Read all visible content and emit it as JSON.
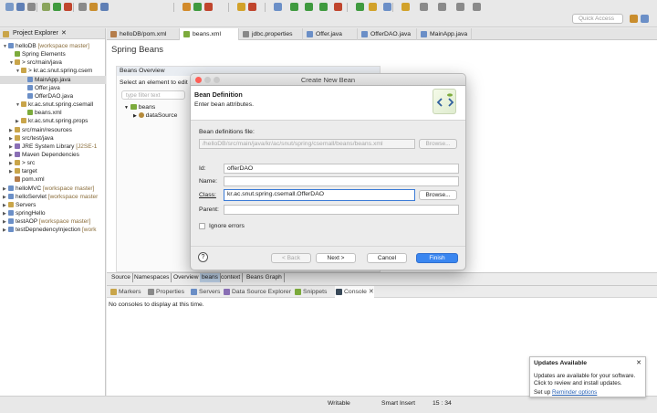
{
  "toolbar": {
    "quick_access_placeholder": "Quick Access"
  },
  "explorer": {
    "title": "Project Explorer",
    "tree": [
      {
        "indent": 0,
        "arrow": "▼",
        "label": "helloDB",
        "deco": " [workspace master]",
        "icon_color": "#6b8fc7"
      },
      {
        "indent": 1,
        "arrow": "",
        "label": "Spring Elements",
        "deco": "",
        "icon_color": "#7cab3c"
      },
      {
        "indent": 1,
        "arrow": "▼",
        "label": "> src/main/java",
        "deco": "",
        "icon_color": "#c9a54a"
      },
      {
        "indent": 2,
        "arrow": "▼",
        "label": "> kr.ac.snut.spring.csem",
        "deco": "",
        "icon_color": "#c9a54a"
      },
      {
        "indent": 3,
        "arrow": "",
        "label": "MainApp.java",
        "deco": "",
        "icon_color": "#6b8fc7",
        "selected": true
      },
      {
        "indent": 3,
        "arrow": "",
        "label": "Offer.java",
        "deco": "",
        "icon_color": "#6b8fc7"
      },
      {
        "indent": 3,
        "arrow": "",
        "label": "OfferDAO.java",
        "deco": "",
        "icon_color": "#6b8fc7"
      },
      {
        "indent": 2,
        "arrow": "▼",
        "label": "kr.ac.snut.spring.csemall",
        "deco": "",
        "icon_color": "#c9a54a"
      },
      {
        "indent": 3,
        "arrow": "",
        "label": "beans.xml",
        "deco": "",
        "icon_color": "#7cab3c"
      },
      {
        "indent": 2,
        "arrow": "▶",
        "label": "kr.ac.snut.spring.props",
        "deco": "",
        "icon_color": "#c9a54a"
      },
      {
        "indent": 1,
        "arrow": "▶",
        "label": "src/main/resources",
        "deco": "",
        "icon_color": "#c9a54a"
      },
      {
        "indent": 1,
        "arrow": "▶",
        "label": "src/test/java",
        "deco": "",
        "icon_color": "#c9a54a"
      },
      {
        "indent": 1,
        "arrow": "▶",
        "label": "JRE System Library",
        "deco": " [J2SE-1",
        "icon_color": "#8a6fb5"
      },
      {
        "indent": 1,
        "arrow": "▶",
        "label": "Maven Dependencies",
        "deco": "",
        "icon_color": "#8a6fb5"
      },
      {
        "indent": 1,
        "arrow": "▶",
        "label": "> src",
        "deco": "",
        "icon_color": "#c9a54a"
      },
      {
        "indent": 1,
        "arrow": "▶",
        "label": "target",
        "deco": "",
        "icon_color": "#c9a54a"
      },
      {
        "indent": 1,
        "arrow": "",
        "label": "pom.xml",
        "deco": "",
        "icon_color": "#b57d4a"
      },
      {
        "indent": 0,
        "arrow": "▶",
        "label": "helloMVC",
        "deco": " [workspace master]",
        "icon_color": "#6b8fc7"
      },
      {
        "indent": 0,
        "arrow": "▶",
        "label": "helloServlet",
        "deco": " [workspace master",
        "icon_color": "#6b8fc7"
      },
      {
        "indent": 0,
        "arrow": "▶",
        "label": "Servers",
        "deco": "",
        "icon_color": "#c9a54a"
      },
      {
        "indent": 0,
        "arrow": "▶",
        "label": "springHello",
        "deco": "",
        "icon_color": "#6b8fc7"
      },
      {
        "indent": 0,
        "arrow": "▶",
        "label": "testAOP",
        "deco": " [workspace master]",
        "icon_color": "#6b8fc7"
      },
      {
        "indent": 0,
        "arrow": "▶",
        "label": "testDepnedencyInjection",
        "deco": " [work",
        "icon_color": "#6b8fc7"
      }
    ]
  },
  "editor_tabs": [
    {
      "label": "helloDB/pom.xml",
      "icon_color": "#b57d4a",
      "active": false
    },
    {
      "label": "beans.xml",
      "icon_color": "#7cab3c",
      "active": true
    },
    {
      "label": "jdbc.properties",
      "icon_color": "#888888",
      "active": false
    },
    {
      "label": "Offer.java",
      "icon_color": "#6b8fc7",
      "active": false
    },
    {
      "label": "OfferDAO.java",
      "icon_color": "#6b8fc7",
      "active": false
    },
    {
      "label": "MainApp.java",
      "icon_color": "#6b8fc7",
      "active": false
    }
  ],
  "editor": {
    "title": "Spring Beans",
    "beans_overview": {
      "title": "Beans Overview",
      "hint": "Select an element to edit it",
      "filter_placeholder": "type filter text",
      "tree": [
        "beans",
        "dataSource"
      ]
    }
  },
  "bottom_tabs": [
    "Source",
    "Namespaces",
    "Overview",
    "beans",
    "context",
    "Beans Graph"
  ],
  "console_panel": {
    "tabs": [
      {
        "label": "Markers",
        "active": false
      },
      {
        "label": "Properties",
        "active": false
      },
      {
        "label": "Servers",
        "active": false
      },
      {
        "label": "Data Source Explorer",
        "active": false
      },
      {
        "label": "Snippets",
        "active": false
      },
      {
        "label": "Console",
        "active": true
      }
    ],
    "empty_message": "No consoles to display at this time."
  },
  "status": {
    "mode": "Writable",
    "insert": "Smart Insert",
    "position": "15 : 34"
  },
  "updates": {
    "title": "Updates Available",
    "message": "Updates are available for your software. Click to review and install updates.",
    "setup_prefix": "Set up ",
    "setup_link": "Reminder options"
  },
  "dialog": {
    "title": "Create New Bean",
    "header_title": "Bean Definition",
    "header_subtitle": "Enter bean attributes.",
    "bean_file_label": "Bean definitions file:",
    "bean_file_value": "/helloDB/src/main/java/kr/ac/snut/spring/csemall/beans/beans.xml",
    "browse_label": "Browse...",
    "id_label": "Id:",
    "id_value": "offerDAO",
    "name_label": "Name:",
    "name_value": "",
    "class_label": "Class:",
    "class_value": "kr.ac.snut.spring.csemall.OfferDAO",
    "parent_label": "Parent:",
    "parent_value": "",
    "ignore_errors_label": "Ignore errors",
    "help_label": "?",
    "back_label": "< Back",
    "next_label": "Next >",
    "cancel_label": "Cancel",
    "finish_label": "Finish"
  },
  "colors": {
    "accent": "#3a86f0",
    "selection": "#dcdcdc",
    "link": "#2a63b5"
  }
}
